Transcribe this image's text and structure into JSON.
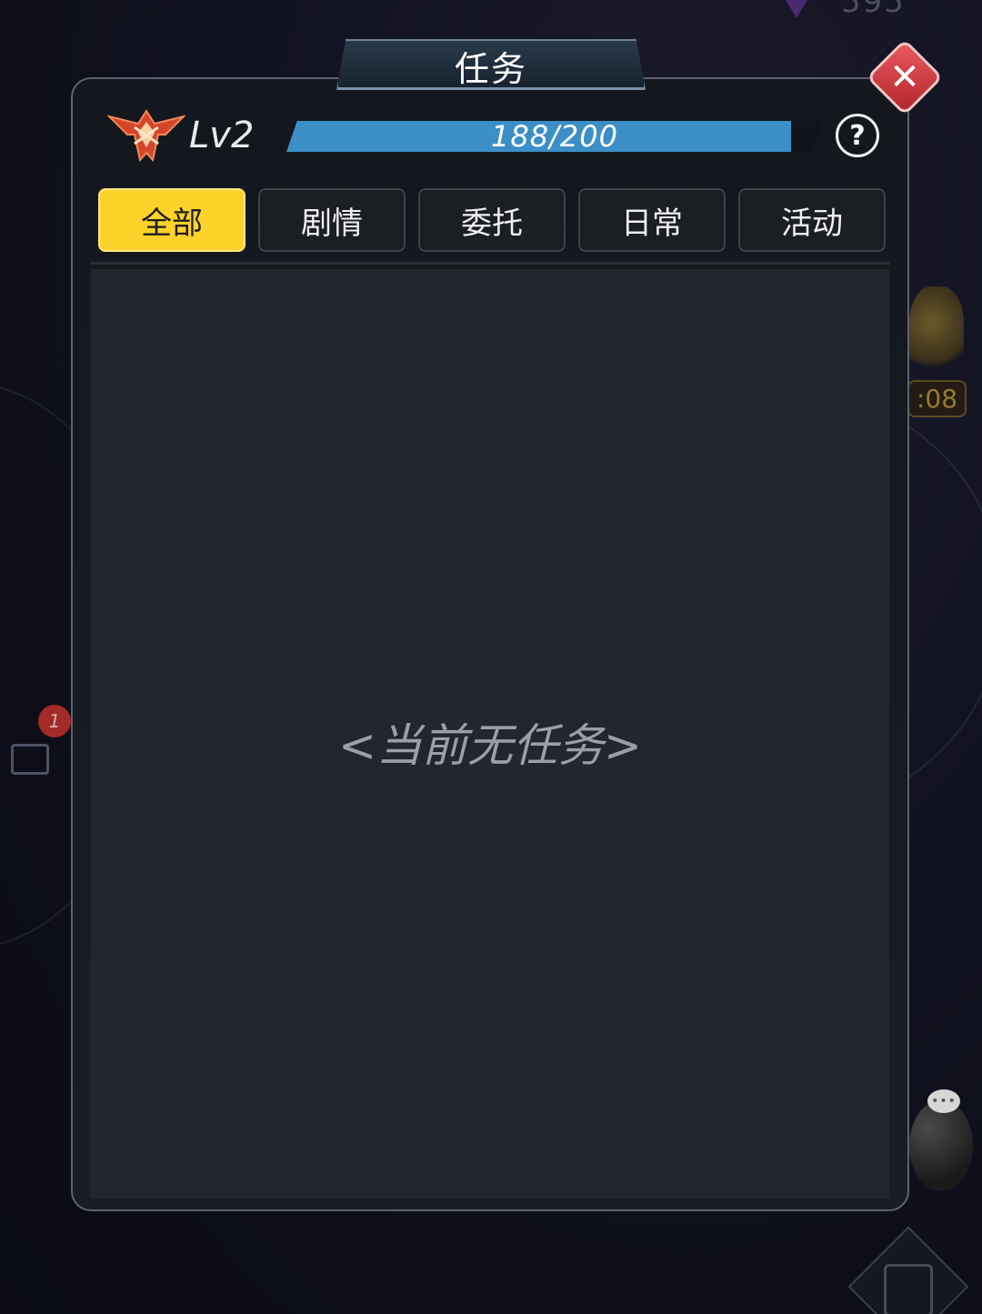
{
  "background": {
    "top_counter": "595",
    "notification_count": "1",
    "timer_text": ":08",
    "chat_bubble": "•••"
  },
  "dialog": {
    "title": "任务",
    "close_glyph": "✕",
    "level": "Lv2",
    "xp": {
      "text": "188/200",
      "current": 188,
      "max": 200
    },
    "help_glyph": "?",
    "tabs": [
      {
        "label": "全部",
        "active": true
      },
      {
        "label": "剧情",
        "active": false
      },
      {
        "label": "委托",
        "active": false
      },
      {
        "label": "日常",
        "active": false
      },
      {
        "label": "活动",
        "active": false
      }
    ],
    "empty_message": "<当前无任务>"
  },
  "colors": {
    "accent_yellow": "#fdd22a",
    "xp_blue": "#3b8fc6",
    "close_red": "#d0383f"
  },
  "icons": {
    "rank_emblem": "rank-emblem-icon",
    "close": "close-icon",
    "help": "help-icon"
  }
}
